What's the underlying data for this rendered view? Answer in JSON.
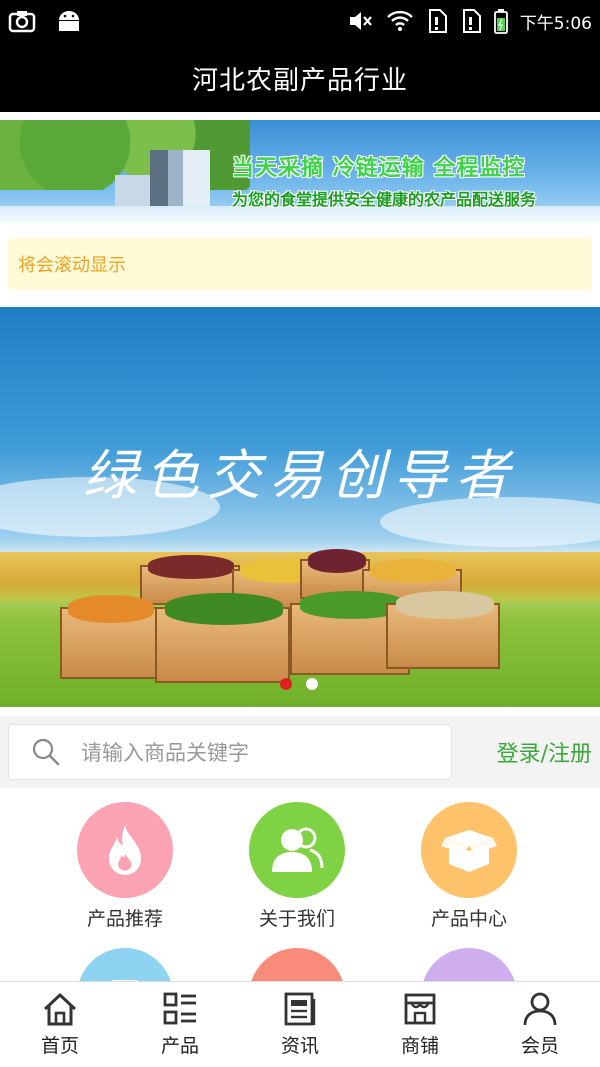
{
  "status_bar": {
    "time": "下午5:06",
    "icons": [
      "screenshot-icon",
      "android-icon",
      "mute-icon",
      "wifi-icon",
      "sim1-icon",
      "sim2-icon",
      "battery-icon"
    ]
  },
  "header": {
    "title": "河北农副产品行业"
  },
  "top_banner": {
    "slogan_line1": "当天采摘 冷链运输 全程监控",
    "slogan_line2": "为您的食堂提供安全健康的农产品配送服务"
  },
  "notice": {
    "text": "将会滚动显示"
  },
  "hero": {
    "slogan": "绿色交易创导者",
    "slide_count": 2,
    "active_slide": 1
  },
  "search": {
    "placeholder": "请输入商品关键字",
    "login_label": "登录/注册"
  },
  "grid": {
    "items": [
      {
        "label": "产品推荐",
        "icon": "fire-icon",
        "color": "#fba3b1"
      },
      {
        "label": "关于我们",
        "icon": "people-icon",
        "color": "#7ed243"
      },
      {
        "label": "产品中心",
        "icon": "box-icon",
        "color": "#fec26b"
      },
      {
        "label": "",
        "icon": "doc-icon",
        "color": "#8fd3f2"
      },
      {
        "label": "",
        "icon": "chat-icon",
        "color": "#f98b7a"
      },
      {
        "label": "",
        "icon": "user-icon",
        "color": "#cfaef0"
      }
    ]
  },
  "bottom_nav": {
    "items": [
      {
        "label": "首页",
        "icon": "home-icon"
      },
      {
        "label": "产品",
        "icon": "grid-list-icon"
      },
      {
        "label": "资讯",
        "icon": "news-icon"
      },
      {
        "label": "商铺",
        "icon": "shop-icon"
      },
      {
        "label": "会员",
        "icon": "member-icon"
      }
    ]
  }
}
